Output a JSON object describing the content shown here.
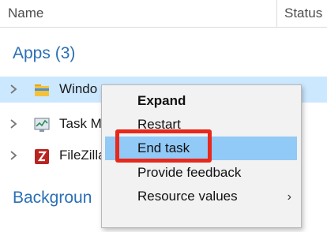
{
  "header": {
    "name_label": "Name",
    "status_label": "Status"
  },
  "groups": {
    "apps_title": "Apps (3)",
    "background_title": "Backgroun"
  },
  "rows": [
    {
      "label": "Windo",
      "icon": "folder-icon"
    },
    {
      "label": "Task M",
      "icon": "task-manager-icon"
    },
    {
      "label": "FileZilla",
      "icon": "filezilla-icon"
    }
  ],
  "context_menu": {
    "items": [
      {
        "label": "Expand",
        "bold": true
      },
      {
        "label": "Restart"
      },
      {
        "label": "End task",
        "state": "hover"
      },
      {
        "label": "Provide feedback"
      },
      {
        "label": "Resource values",
        "submenu_arrow": "›"
      },
      {
        "label": ""
      }
    ]
  },
  "colors": {
    "group_title": "#2a6fb6",
    "selected_row": "#cce8ff",
    "menu_hover": "#91c9f7",
    "highlight_box": "#e8281b"
  }
}
